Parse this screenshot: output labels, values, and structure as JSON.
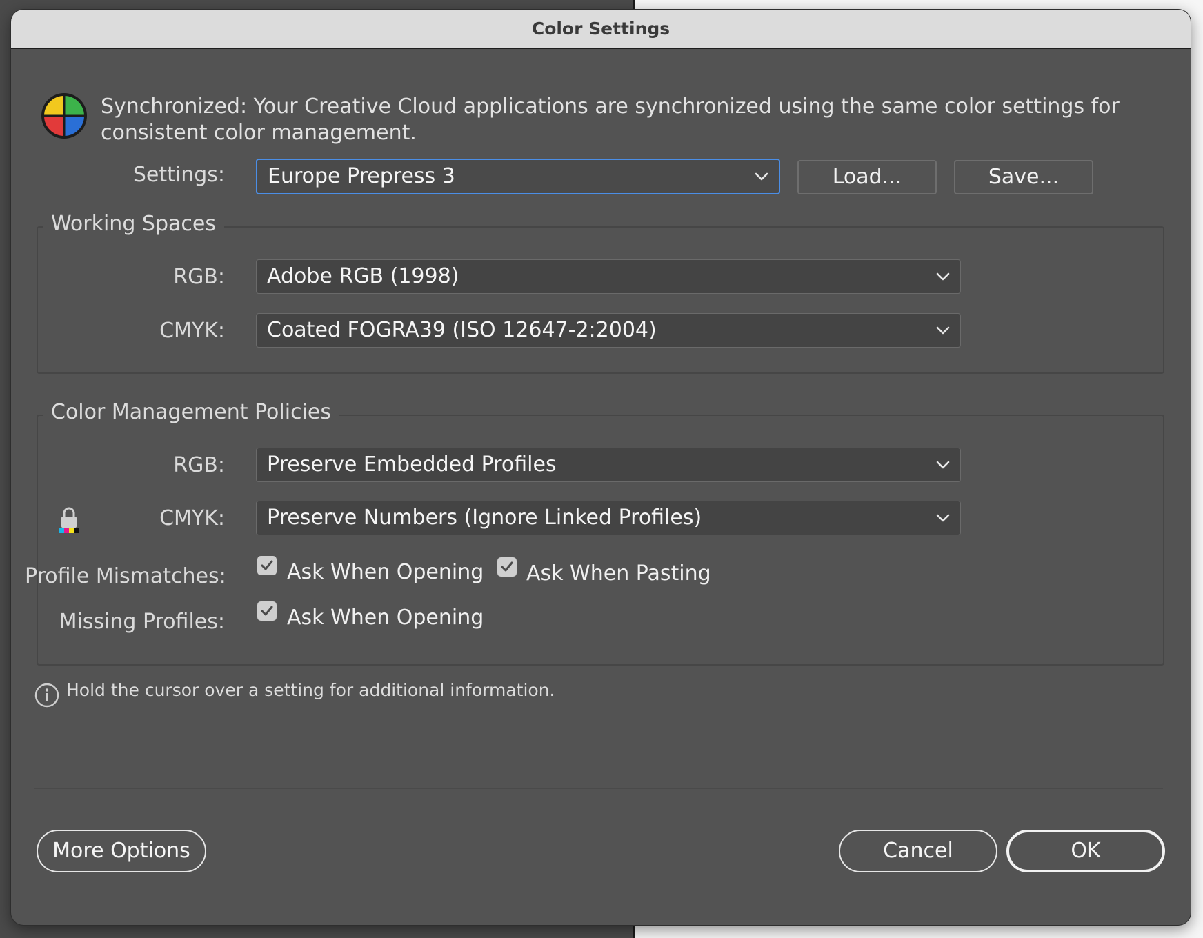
{
  "window": {
    "title": "Color Settings"
  },
  "sync": {
    "icon": "color-wheel-icon",
    "message": "Synchronized: Your Creative Cloud applications are synchronized using the same color settings for consistent color management."
  },
  "settings": {
    "label": "Settings:",
    "value": "Europe Prepress 3",
    "load_label": "Load...",
    "save_label": "Save..."
  },
  "working_spaces": {
    "title": "Working Spaces",
    "rgb_label": "RGB:",
    "rgb_value": "Adobe RGB (1998)",
    "cmyk_label": "CMYK:",
    "cmyk_value": "Coated FOGRA39 (ISO 12647-2:2004)"
  },
  "policies": {
    "title": "Color Management Policies",
    "rgb_label": "RGB:",
    "rgb_value": "Preserve Embedded Profiles",
    "cmyk_label": "CMYK:",
    "cmyk_value": "Preserve Numbers (Ignore Linked Profiles)",
    "cmyk_lock_icon": "cmyk-lock-icon",
    "profile_mismatches_label": "Profile Mismatches:",
    "mismatch_ask_opening": {
      "label": "Ask When Opening",
      "checked": true
    },
    "mismatch_ask_pasting": {
      "label": "Ask When Pasting",
      "checked": true
    },
    "missing_profiles_label": "Missing Profiles:",
    "missing_ask_opening": {
      "label": "Ask When Opening",
      "checked": true
    }
  },
  "info": {
    "icon": "info-icon",
    "text": "Hold the cursor over a setting for additional information."
  },
  "footer": {
    "more_options_label": "More Options",
    "cancel_label": "Cancel",
    "ok_label": "OK"
  },
  "colors": {
    "dialog_bg": "#535353",
    "titlebar_bg": "#dcdcdc",
    "focus_ring": "#4b8ee6",
    "field_bg": "#444444"
  }
}
